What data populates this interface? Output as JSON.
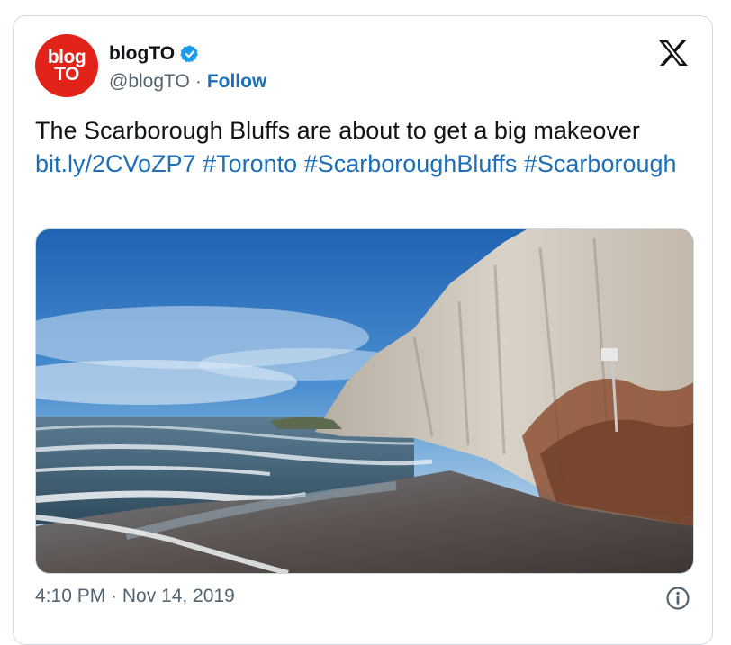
{
  "author": {
    "avatar_line1": "blog",
    "avatar_line2": "TO",
    "name": "blogTO",
    "handle": "@blogTO",
    "separator": "·",
    "follow_label": "Follow"
  },
  "tweet": {
    "text": "The Scarborough Bluffs are about to get a big makeover",
    "link": "bit.ly/2CVoZP7",
    "hashtags": [
      "#Toronto",
      "#ScarboroughBluffs",
      "#Scarborough"
    ]
  },
  "meta": {
    "timestamp": "4:10 PM · Nov 14, 2019"
  },
  "icons": {
    "verified": "verified-badge-icon",
    "x_logo": "x-logo-icon",
    "info": "info-icon"
  },
  "colors": {
    "link": "#1d70b8",
    "avatar_bg": "#e2231a",
    "verified": "#1d9bf0"
  }
}
